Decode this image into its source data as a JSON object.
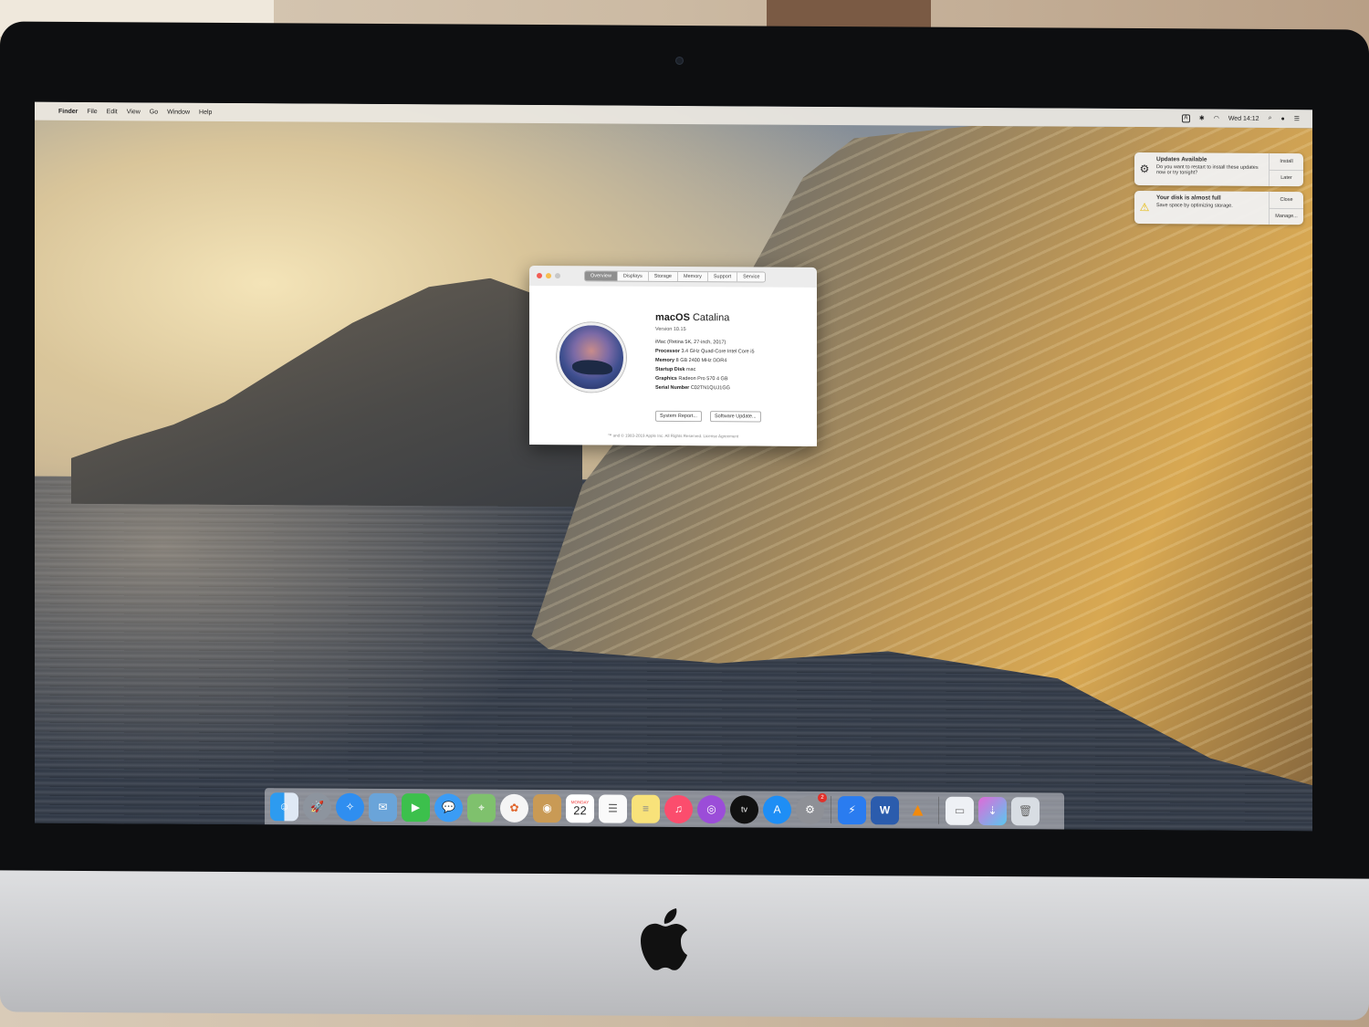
{
  "menubar": {
    "app": "Finder",
    "items": [
      "File",
      "Edit",
      "View",
      "Go",
      "Window",
      "Help"
    ],
    "input_badge": "A",
    "clock": "Wed 14:12"
  },
  "notifications": [
    {
      "title": "Updates Available",
      "body": "Do you want to restart to install these updates now or try tonight?",
      "actions": [
        "Install",
        "Later"
      ],
      "icon": "gear-icon"
    },
    {
      "title": "Your disk is almost full",
      "body": "Save space by optimizing storage.",
      "actions": [
        "Close",
        "Manage..."
      ],
      "icon": "warning-icon"
    }
  ],
  "about": {
    "tabs": [
      "Overview",
      "Displays",
      "Storage",
      "Memory",
      "Support",
      "Service"
    ],
    "os_name": "macOS",
    "os_codename": "Catalina",
    "version": "Version 10.15",
    "model": "iMac (Retina 5K, 27-inch, 2017)",
    "specs": [
      {
        "label": "Processor",
        "value": "3.4 GHz Quad-Core Intel Core i5"
      },
      {
        "label": "Memory",
        "value": "8 GB 2400 MHz DDR4"
      },
      {
        "label": "Startup Disk",
        "value": "mac"
      },
      {
        "label": "Graphics",
        "value": "Radeon Pro 570 4 GB"
      },
      {
        "label": "Serial Number",
        "value": "C02TN1QUJ1GG"
      }
    ],
    "buttons": [
      "System Report...",
      "Software Update..."
    ],
    "copyright": "™ and © 1983-2019 Apple Inc. All Rights Reserved. License Agreement"
  },
  "dock": {
    "calendar_month": "MONDAY",
    "calendar_day": "22",
    "tv_label": "tv",
    "word_label": "W",
    "settings_badge": "2",
    "items": [
      "finder-icon",
      "launchpad-icon",
      "safari-icon",
      "mail-icon",
      "facetime-icon",
      "messages-icon",
      "maps-icon",
      "photos-icon",
      "contacts-icon",
      "calendar-icon",
      "reminders-icon",
      "notes-icon",
      "music-icon",
      "podcasts-icon",
      "tv-icon",
      "app-store-icon",
      "system-preferences-icon",
      "spark-icon",
      "word-icon",
      "vlc-icon",
      "document-icon",
      "downloads-icon",
      "trash-icon"
    ]
  },
  "colors": {
    "menubar_bg": "#ece8e2",
    "tab_active": "#8f8f8f",
    "badge_red": "#e0302a"
  }
}
